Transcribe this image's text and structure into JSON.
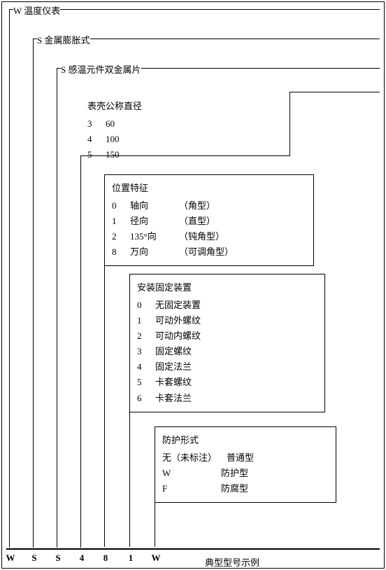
{
  "levels": [
    {
      "code": "W",
      "label": "温度仪表"
    },
    {
      "code": "S",
      "label": "金属膨胀式"
    },
    {
      "code": "S",
      "label": "感温元件双金属片"
    }
  ],
  "diameter": {
    "title": "表壳公称直径",
    "items": [
      {
        "code": "3",
        "value": "60"
      },
      {
        "code": "4",
        "value": "100"
      },
      {
        "code": "5",
        "value": "150"
      }
    ]
  },
  "position": {
    "title": "位置特征",
    "items": [
      {
        "code": "0",
        "name": "轴向",
        "note": "（角型）"
      },
      {
        "code": "1",
        "name": "径向",
        "note": "（直型）"
      },
      {
        "code": "2",
        "name": "135°向",
        "note": "（钝角型）"
      },
      {
        "code": "8",
        "name": "万向",
        "note": "（可调角型）"
      }
    ]
  },
  "mount": {
    "title": "安装固定装置",
    "items": [
      {
        "code": "0",
        "value": "无固定装置"
      },
      {
        "code": "1",
        "value": "可动外螺纹"
      },
      {
        "code": "2",
        "value": "可动内螺纹"
      },
      {
        "code": "3",
        "value": "固定螺纹"
      },
      {
        "code": "4",
        "value": "固定法兰"
      },
      {
        "code": "5",
        "value": "卡套螺纹"
      },
      {
        "code": "6",
        "value": "卡套法兰"
      }
    ]
  },
  "protect": {
    "title": "防护形式",
    "items": [
      {
        "code": "无（未标注）",
        "value": "普通型"
      },
      {
        "code": "W",
        "value": "防护型"
      },
      {
        "code": "F",
        "value": "防腐型"
      }
    ]
  },
  "example": {
    "label": "典型型号示例",
    "codes": [
      "W",
      "S",
      "S",
      "4",
      "8",
      "1",
      "W"
    ]
  }
}
